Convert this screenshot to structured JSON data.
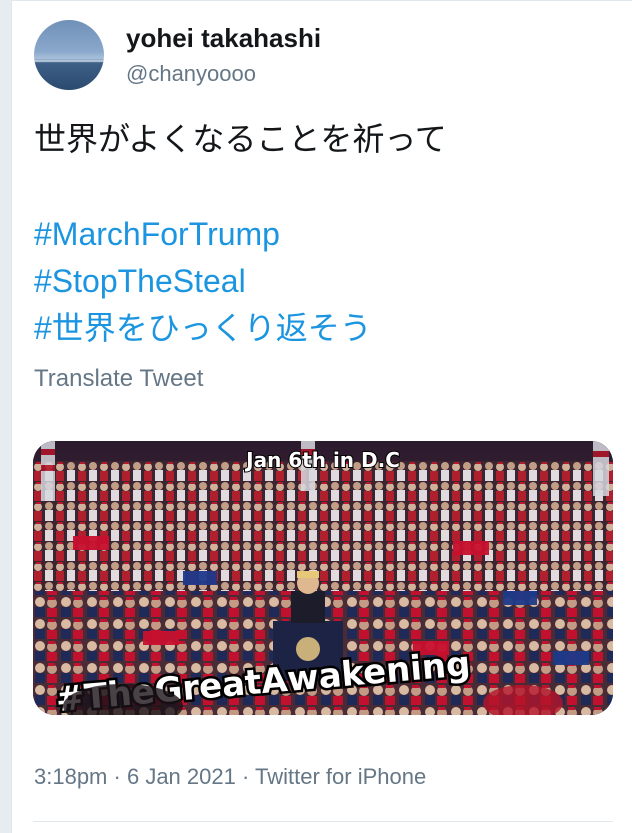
{
  "tweet": {
    "display_name": "yohei takahashi",
    "handle": "@chanyoooo",
    "text_line1": "世界がよくなることを祈って",
    "hashtags": [
      "#MarchForTrump",
      "#StopTheSteal",
      "#世界をひっくり返そう"
    ],
    "translate_label": "Translate Tweet",
    "media": {
      "top_caption": "Jan 6th in D.C",
      "bottom_caption": "#TheGreatAwakening"
    },
    "time": "3:18pm",
    "date": "6 Jan 2021",
    "source": "Twitter for iPhone",
    "separator": "·"
  },
  "colors": {
    "link": "#1b95e0",
    "secondary_text": "#657786",
    "primary_text": "#14171a"
  }
}
